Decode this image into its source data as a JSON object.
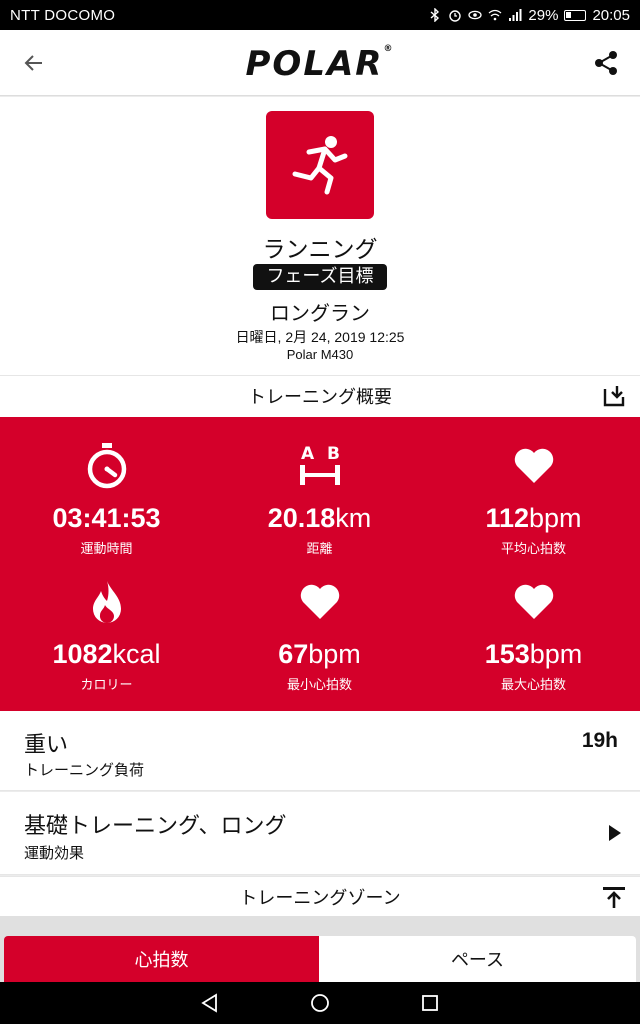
{
  "status_bar": {
    "carrier": "NTT DOCOMO",
    "battery": "29%",
    "time": "20:05"
  },
  "app_bar": {
    "logo": "POLAR"
  },
  "workout": {
    "sport": "ランニング",
    "phase_badge": "フェーズ目標",
    "phase_name": "ロングラン",
    "datetime": "日曜日, 2月 24, 2019 12:25",
    "device": "Polar M430"
  },
  "summary_header": "トレーニング概要",
  "summary": [
    {
      "value": "03:41:53",
      "unit": "",
      "label": "運動時間",
      "icon": "stopwatch-icon"
    },
    {
      "value": "20.18",
      "unit": "km",
      "label": "距離",
      "icon": "distance-ab-icon"
    },
    {
      "value": "112",
      "unit": "bpm",
      "label": "平均心拍数",
      "icon": "heart-icon"
    },
    {
      "value": "1082",
      "unit": "kcal",
      "label": "カロリー",
      "icon": "flame-icon"
    },
    {
      "value": "67",
      "unit": "bpm",
      "label": "最小心拍数",
      "icon": "heart-icon"
    },
    {
      "value": "153",
      "unit": "bpm",
      "label": "最大心拍数",
      "icon": "heart-icon"
    }
  ],
  "training_load": {
    "title": "重い",
    "subtitle": "トレーニング負荷",
    "value": "19h"
  },
  "training_benefit": {
    "title": "基礎トレーニング、ロング",
    "subtitle": "運動効果"
  },
  "zones_header": "トレーニングゾーン",
  "tabs": [
    {
      "label": "心拍数",
      "active": true
    },
    {
      "label": "ペース",
      "active": false
    }
  ],
  "colors": {
    "brand_red": "#d4002a"
  }
}
